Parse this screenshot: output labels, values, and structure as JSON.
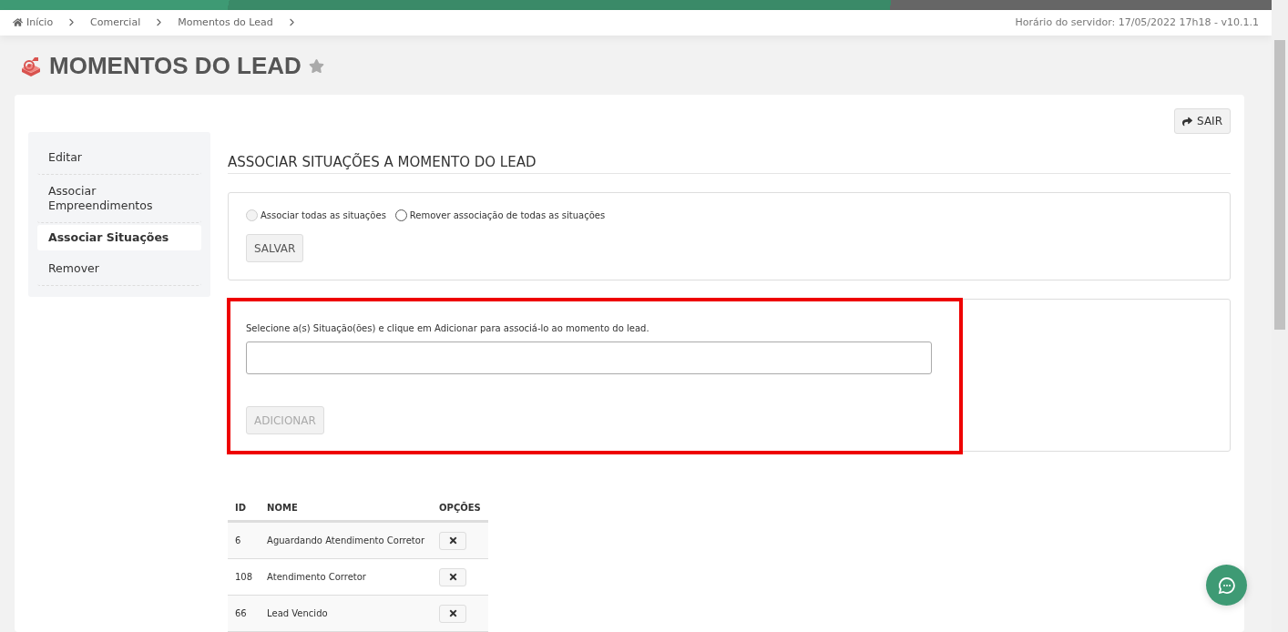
{
  "breadcrumb": [
    {
      "label": "Início",
      "kind": "home"
    },
    {
      "label": "Comercial",
      "kind": "link"
    },
    {
      "label": "Momentos do Lead",
      "kind": "link"
    }
  ],
  "server_info": "Horário do servidor: 17/05/2022 17h18 - v10.1.1",
  "page_title": "MOMENTOS DO LEAD",
  "exit_button": "SAIR",
  "sidebar": {
    "items": [
      {
        "label": "Editar",
        "selected": false
      },
      {
        "label": "Associar Empreendimentos",
        "selected": false
      },
      {
        "label": "Associar Situações",
        "selected": true
      },
      {
        "label": "Remover",
        "selected": false
      }
    ]
  },
  "section_title": "ASSOCIAR SITUAÇÕES A MOMENTO DO LEAD",
  "bulk_options": [
    {
      "label": "Associar todas as situações",
      "selected": false,
      "disabled": true
    },
    {
      "label": "Remover associação de todas as situações",
      "selected": false,
      "disabled": false
    }
  ],
  "save_button": "SALVAR",
  "add_panel": {
    "instruction": "Selecione a(s) Situação(ões) e clique em Adicionar para associá-lo ao momento do lead.",
    "button": "ADICIONAR",
    "button_disabled": true,
    "highlighted": true
  },
  "table": {
    "columns": [
      "ID",
      "NOME",
      "OPÇÕES"
    ],
    "rows": [
      {
        "id": "6",
        "name": "Aguardando Atendimento Corretor"
      },
      {
        "id": "108",
        "name": "Atendimento Corretor"
      },
      {
        "id": "66",
        "name": "Lead Vencido"
      }
    ]
  }
}
